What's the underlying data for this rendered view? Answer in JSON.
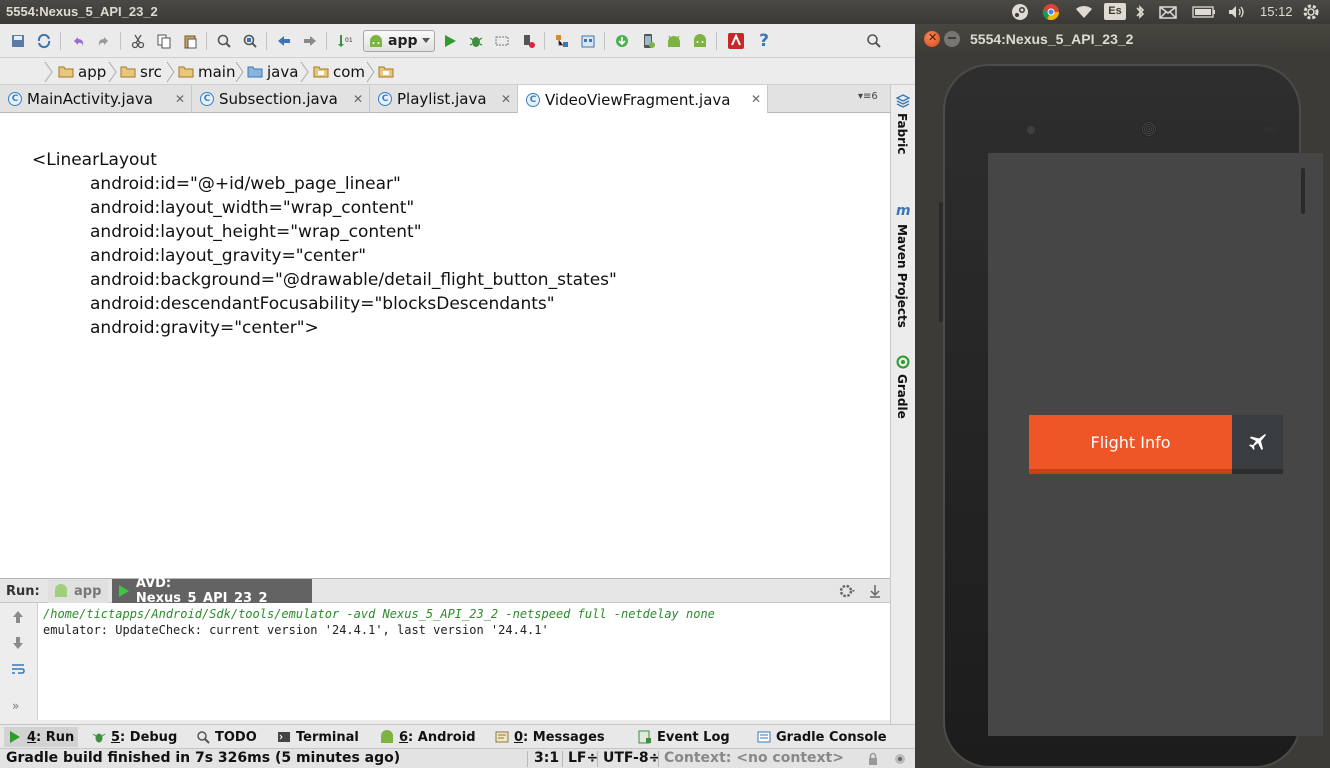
{
  "window_title": "5554:Nexus_5_API_23_2",
  "system_tray": {
    "keyboard_layout": "Es",
    "clock": "15:12",
    "icons": [
      "steam-icon",
      "chrome-icon",
      "wifi-icon",
      "keyboard-icon",
      "bluetooth-icon",
      "mail-icon",
      "battery-icon",
      "volume-icon",
      "gear-icon"
    ]
  },
  "toolbar": {
    "run_config": "app"
  },
  "breadcrumbs": [
    "app",
    "src",
    "main",
    "java",
    "com",
    ""
  ],
  "editor_tabs": [
    {
      "label": "MainActivity.java",
      "active": false
    },
    {
      "label": "Subsection.java",
      "active": false
    },
    {
      "label": "Playlist.java",
      "active": false
    },
    {
      "label": "VideoViewFragment.java",
      "active": true
    }
  ],
  "tab_overflow": "6",
  "code_lines": [
    "<LinearLayout",
    "android:id=\"@+id/web_page_linear\"",
    "android:layout_width=\"wrap_content\"",
    "android:layout_height=\"wrap_content\"",
    "android:layout_gravity=\"center\"",
    "android:background=\"@drawable/detail_flight_button_states\"",
    "android:descendantFocusability=\"blocksDescendants\"",
    "android:gravity=\"center\">"
  ],
  "right_tool_tabs": [
    "Fabric",
    "Maven Projects",
    "Gradle"
  ],
  "run_panel": {
    "label": "Run:",
    "tabs": [
      "app",
      "AVD: Nexus_5_API_23_2"
    ],
    "console_cmd": "/home/tictapps/Android/Sdk/tools/emulator -avd Nexus_5_API_23_2 -netspeed full -netdelay none",
    "console_msg": "emulator: UpdateCheck: current version '24.4.1', last version '24.4.1'"
  },
  "tool_windows": [
    {
      "num": "4",
      "label": ": Run"
    },
    {
      "num": "5",
      "label": ": Debug"
    },
    {
      "num": "",
      "label": "TODO"
    },
    {
      "num": "",
      "label": "Terminal"
    },
    {
      "num": "6",
      "label": ": Android"
    },
    {
      "num": "0",
      "label": ": Messages"
    },
    {
      "num": "",
      "label": "Event Log"
    },
    {
      "num": "",
      "label": "Gradle Console"
    }
  ],
  "status": {
    "message": "Gradle build finished in 7s 326ms (5 minutes ago)",
    "position": "3:1",
    "line_sep": "LF÷",
    "encoding": "UTF-8÷",
    "context": "Context: <no context>"
  },
  "emulator": {
    "title": "5554:Nexus_5_API_23_2",
    "button_label": "Flight Info"
  },
  "colors": {
    "accent_orange": "#ee5627",
    "console_cmd_green": "#2d8a2d",
    "screen_bg": "#464646"
  }
}
